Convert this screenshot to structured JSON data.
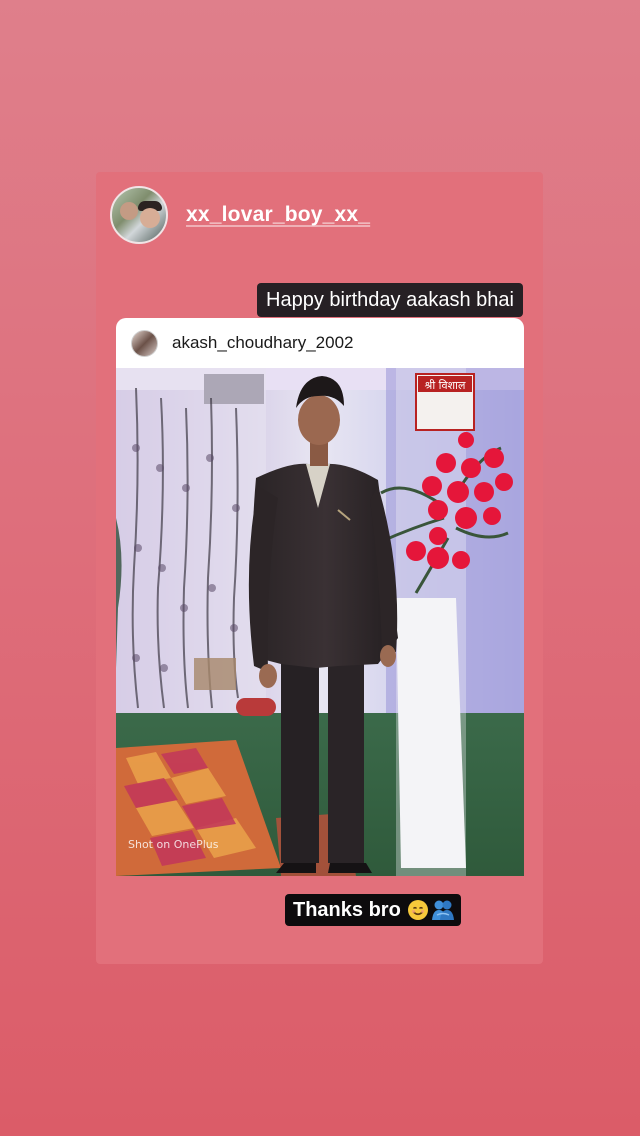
{
  "story": {
    "username": "xx_lovar_boy_xx_",
    "caption_top": "Happy birthday aakash bhai",
    "caption_bottom": "Thanks bro",
    "caption_bottom_emojis": [
      "smiling-face-icon",
      "people-hugging-icon"
    ]
  },
  "shared_post": {
    "username": "akash_choudhary_2002",
    "photo_watermark": "Shot on OnePlus",
    "stand_sign_text": "श्री विशाल"
  },
  "colors": {
    "background_top": "#df7f8b",
    "background_bottom": "#db5c68",
    "caption_bg": "#262024"
  }
}
